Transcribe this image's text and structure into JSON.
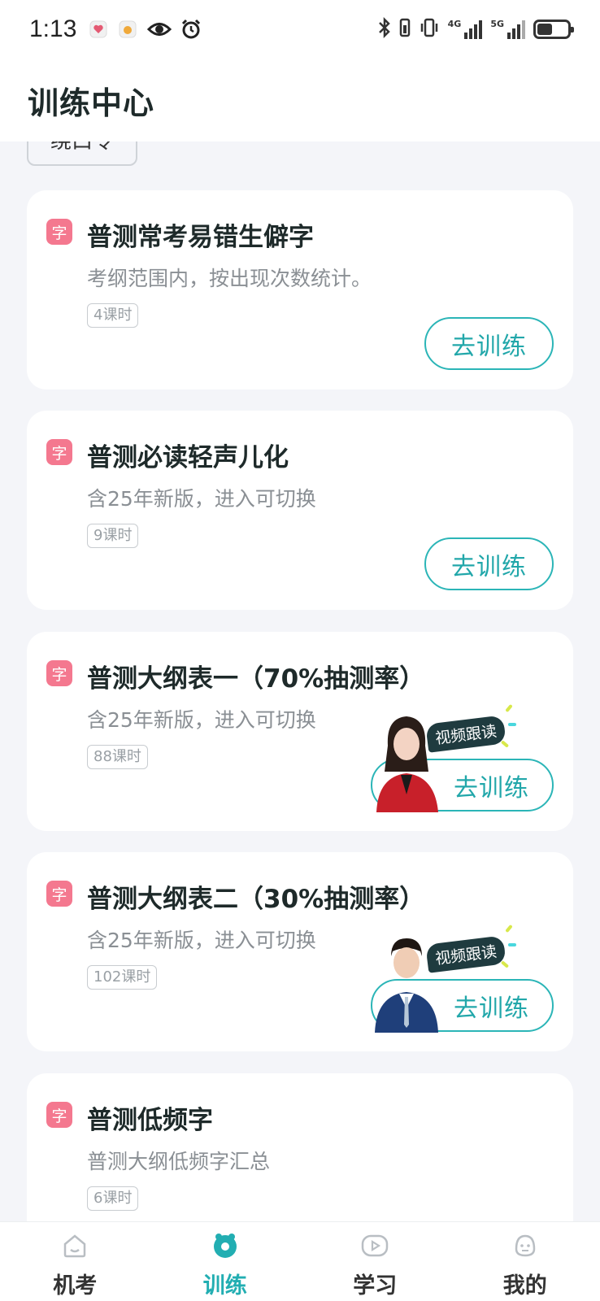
{
  "status_bar": {
    "time": "1:13",
    "signal_1_label": "4G",
    "signal_2_label": "5G",
    "icons": [
      "heart-app-icon",
      "egg-app-icon",
      "eye-icon",
      "alarm-icon",
      "bluetooth-icon",
      "vibrate-icon",
      "signal-4g-icon",
      "signal-5g-icon",
      "battery-icon"
    ],
    "battery_level": 0.5
  },
  "header": {
    "title": "训练中心"
  },
  "filter_chip": {
    "label": "绕口令"
  },
  "cards": [
    {
      "badge": "字",
      "title": "普测常考易错生僻字",
      "desc": "考纲范围内，按出现次数统计。",
      "lessons": "4课时",
      "button": "去训练"
    },
    {
      "badge": "字",
      "title": "普测必读轻声儿化",
      "desc": "含25年新版，进入可切换",
      "lessons": "9课时",
      "button": "去训练"
    },
    {
      "badge": "字",
      "title": "普测大纲表一（70%抽测率）",
      "desc": "含25年新版，进入可切换",
      "lessons": "88课时",
      "button": "去训练",
      "video_tag": "视频跟读"
    },
    {
      "badge": "字",
      "title": "普测大纲表二（30%抽测率）",
      "desc": "含25年新版，进入可切换",
      "lessons": "102课时",
      "button": "去训练",
      "video_tag": "视频跟读"
    },
    {
      "badge": "字",
      "title": "普测低频字",
      "desc": "普测大纲低频字汇总",
      "lessons": "6课时"
    }
  ],
  "bottom_nav": [
    {
      "label": "机考",
      "icon": "home-icon",
      "active": false
    },
    {
      "label": "训练",
      "icon": "training-icon",
      "active": true
    },
    {
      "label": "学习",
      "icon": "play-icon",
      "active": false
    },
    {
      "label": "我的",
      "icon": "profile-icon",
      "active": false
    }
  ],
  "colors": {
    "accent": "#22aeb2",
    "badge": "#f4788f",
    "video_tag_bg": "#1f3b3f"
  }
}
